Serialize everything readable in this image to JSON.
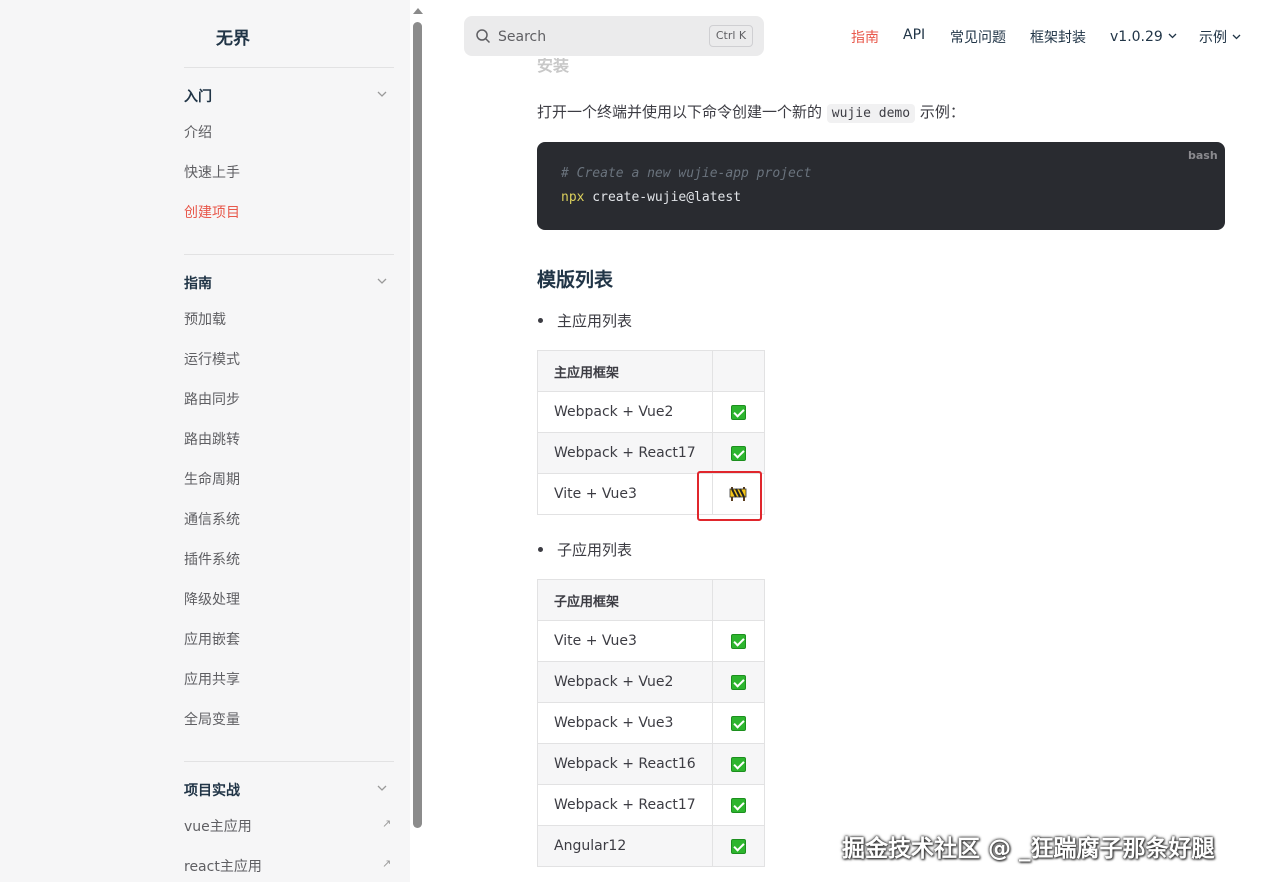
{
  "sidebar": {
    "brand": "无界",
    "sections": [
      {
        "title": "入门",
        "items": [
          "介绍",
          "快速上手",
          "创建项目"
        ],
        "active": "创建项目"
      },
      {
        "title": "指南",
        "items": [
          "预加载",
          "运行模式",
          "路由同步",
          "路由跳转",
          "生命周期",
          "通信系统",
          "插件系统",
          "降级处理",
          "应用嵌套",
          "应用共享",
          "全局变量"
        ]
      },
      {
        "title": "项目实战",
        "items": [
          "vue主应用",
          "react主应用"
        ]
      }
    ],
    "external_icon": "↗"
  },
  "topnav": {
    "search_placeholder": "Search",
    "search_shortcut": "Ctrl K",
    "items": [
      "指南",
      "API",
      "常见问题",
      "框架封装",
      "v1.0.29",
      "示例"
    ],
    "active": "指南"
  },
  "content": {
    "cut_heading": "安装",
    "intro_before": "打开一个终端并使用以下命令创建一个新的",
    "intro_code": "wujie demo",
    "intro_after": "示例：",
    "code": {
      "lang": "bash",
      "comment": "# Create a new wujie-app project",
      "cmd": "npx",
      "args": " create-wujie@latest"
    },
    "heading": "模版列表",
    "main_list_label": "主应用列表",
    "main_table": {
      "header": "主应用框架",
      "rows": [
        {
          "name": "Webpack + Vue2",
          "status": "check"
        },
        {
          "name": "Webpack + React17",
          "status": "check"
        },
        {
          "name": "Vite + Vue3",
          "status": "construction"
        }
      ]
    },
    "sub_list_label": "子应用列表",
    "sub_table": {
      "header": "子应用框架",
      "rows": [
        {
          "name": "Vite + Vue3",
          "status": "check"
        },
        {
          "name": "Webpack + Vue2",
          "status": "check"
        },
        {
          "name": "Webpack + Vue3",
          "status": "check"
        },
        {
          "name": "Webpack + React16",
          "status": "check"
        },
        {
          "name": "Webpack + React17",
          "status": "check"
        },
        {
          "name": "Angular12",
          "status": "check"
        }
      ]
    }
  },
  "watermark": "掘金技术社区 @ _狂踹腐子那条好腿",
  "colors": {
    "accent": "#e8594c",
    "code_bg": "#292b30",
    "highlight_box": "#e0262c",
    "check_green": "#2db52e"
  }
}
